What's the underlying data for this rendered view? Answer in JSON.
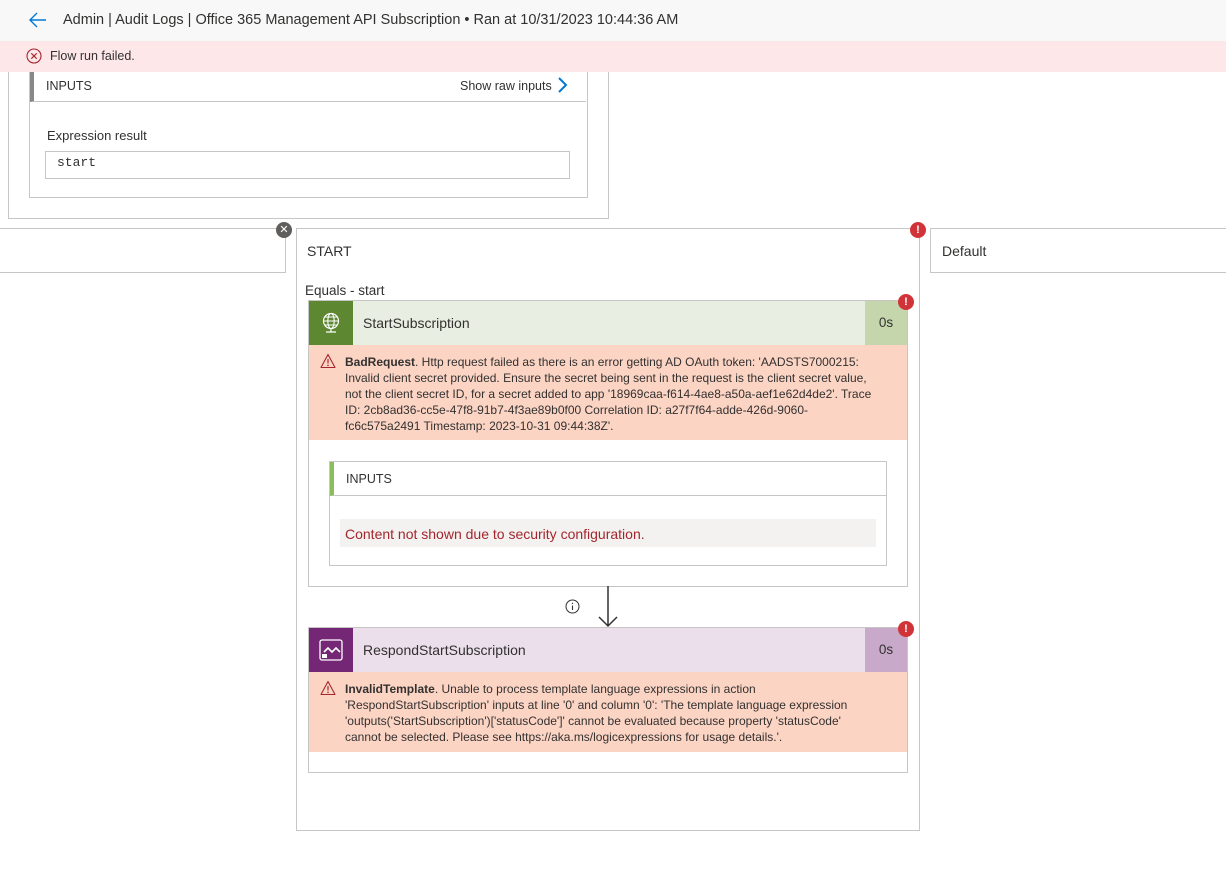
{
  "header": {
    "title": "Admin | Audit Logs | Office 365 Management API Subscription • Ran at 10/31/2023 10:44:36 AM"
  },
  "banner": {
    "message": "Flow run failed."
  },
  "condition": {
    "inputs_label": "INPUTS",
    "show_raw_inputs": "Show raw inputs",
    "expression_label": "Expression result",
    "expression_value": "start"
  },
  "cases": {
    "start_title": "START",
    "default_title": "Default",
    "equals_label": "Equals - start",
    "error_badge": "!",
    "close_glyph": "✕"
  },
  "actions": [
    {
      "name": "StartSubscription",
      "duration": "0s",
      "error_code": "BadRequest",
      "error_message": ". Http request failed as there is an error getting AD OAuth token: 'AADSTS7000215: Invalid client secret provided. Ensure the secret being sent in the request is the client secret value, not the client secret ID, for a secret added to app '18969caa-f614-4ae8-a50a-aef1e62d4de2'. Trace ID: 2cb8ad36-cc5e-47f8-91b7-4f3ae89b0f00 Correlation ID: a27f7f64-adde-426d-9060-fc6c575a2491 Timestamp: 2023-10-31 09:44:38Z'.",
      "inputs_label": "INPUTS",
      "security_message": "Content not shown due to security configuration.",
      "icon": "globe-icon",
      "color": "#5d8731"
    },
    {
      "name": "RespondStartSubscription",
      "duration": "0s",
      "error_code": "InvalidTemplate",
      "error_message": ". Unable to process template language expressions in action 'RespondStartSubscription' inputs at line '0' and column '0': 'The template language expression 'outputs('StartSubscription')['statusCode']' cannot be evaluated because property 'statusCode' cannot be selected. Please see https://aka.ms/logicexpressions for usage details.'.",
      "icon": "response-icon",
      "color": "#742774"
    }
  ],
  "colors": {
    "error_banner": "#fde7e9",
    "error_area": "#fcd4c4",
    "error_badge": "#d13438",
    "security_text": "#a4262c",
    "link_blue": "#0078d4"
  }
}
